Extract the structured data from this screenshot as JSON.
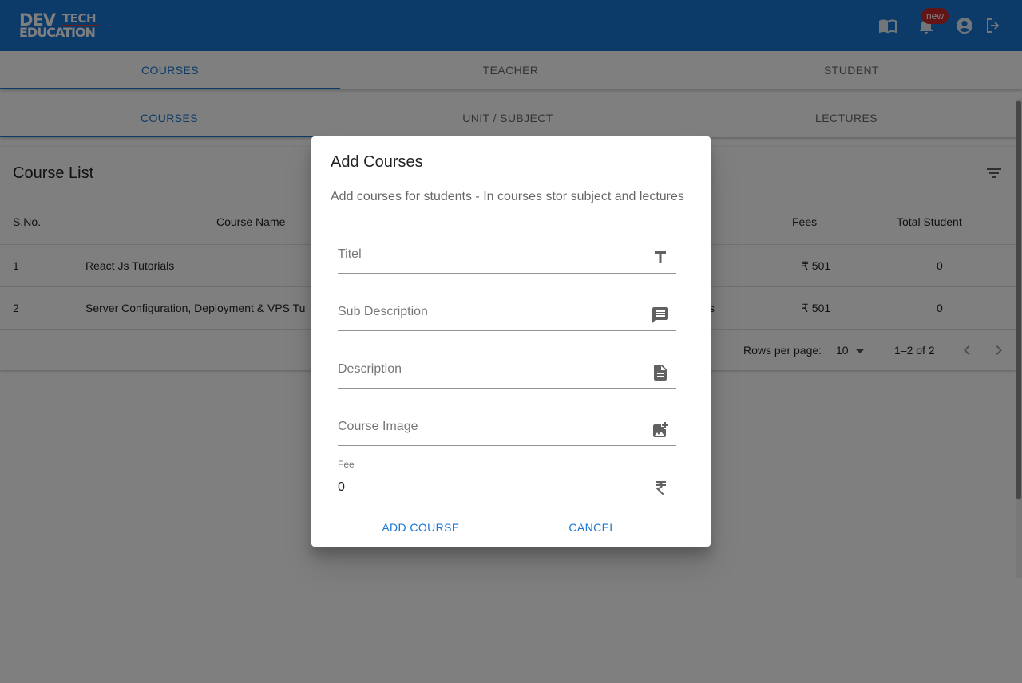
{
  "brand": {
    "dev": "DEV",
    "tech": "TECH",
    "education": "EDUCATION"
  },
  "header": {
    "notification_badge": "new",
    "icons": [
      "menu-book-icon",
      "notifications-icon",
      "account-circle-icon",
      "logout-icon"
    ]
  },
  "top_tabs": [
    {
      "label": "COURSES",
      "active": true
    },
    {
      "label": "TEACHER",
      "active": false
    },
    {
      "label": "STUDENT",
      "active": false
    }
  ],
  "sub_tabs": [
    {
      "label": "COURSES",
      "active": true
    },
    {
      "label": "UNIT / SUBJECT",
      "active": false
    },
    {
      "label": "LECTURES",
      "active": false
    }
  ],
  "course_list": {
    "title": "Course List",
    "columns": [
      "S.No.",
      "Course Name",
      "Fees",
      "Total Student"
    ],
    "rows": [
      {
        "sno": "1",
        "name": "React Js Tutorials",
        "fees": "₹ 501",
        "students": "0",
        "hidden_tail": ""
      },
      {
        "sno": "2",
        "name": "Server Configuration, Deployment & VPS Tu",
        "fees": "₹ 501",
        "students": "0",
        "hidden_tail": "s"
      }
    ],
    "pagination": {
      "rows_per_page_label": "Rows per page:",
      "rows_per_page_value": "10",
      "range": "1–2 of 2"
    }
  },
  "dialog": {
    "title": "Add Courses",
    "subtitle": "Add courses for students - In courses stor subject and lectures",
    "fields": {
      "title": {
        "placeholder": "Titel",
        "icon": "title-icon"
      },
      "sub_description": {
        "placeholder": "Sub Description",
        "icon": "message-icon"
      },
      "description": {
        "placeholder": "Description",
        "icon": "description-icon"
      },
      "course_image": {
        "placeholder": "Course Image",
        "icon": "add-photo-icon"
      },
      "fee": {
        "label": "Fee",
        "value": "0",
        "icon": "rupee-icon"
      }
    },
    "add_button": "ADD COURSE",
    "cancel_button": "CANCEL"
  },
  "colors": {
    "primary": "#1976d2",
    "badge": "#c62828",
    "backdrop": "rgba(0,0,0,0.5)"
  }
}
